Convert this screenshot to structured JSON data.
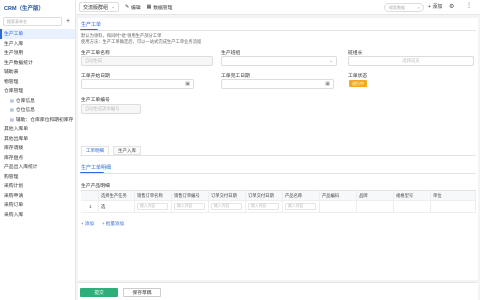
{
  "app": {
    "title": "CRM（生产版）"
  },
  "sidebar": {
    "search_placeholder": "搜索表单名",
    "items": [
      {
        "label": "生产工单",
        "active": true,
        "indent": false
      },
      {
        "label": "生产入库",
        "active": false,
        "indent": false
      },
      {
        "label": "生产领用",
        "active": false,
        "indent": false
      },
      {
        "label": "生产数据统计",
        "active": false,
        "indent": false
      },
      {
        "label": "辅助表",
        "active": false,
        "indent": false
      },
      {
        "label": "物管理",
        "active": false,
        "indent": false
      },
      {
        "label": "仓库管理",
        "active": false,
        "indent": false
      },
      {
        "label": "仓库信息",
        "active": false,
        "indent": true
      },
      {
        "label": "仓位信息",
        "active": false,
        "indent": true
      },
      {
        "label": "辅助：仓库库位和期初库存",
        "active": false,
        "indent": true
      },
      {
        "label": "其他入库单",
        "active": false,
        "indent": false
      },
      {
        "label": "其他出库单",
        "active": false,
        "indent": false
      },
      {
        "label": "库存调拨",
        "active": false,
        "indent": false
      },
      {
        "label": "库存盘点",
        "active": false,
        "indent": false
      },
      {
        "label": "产品出入库统计",
        "active": false,
        "indent": false
      },
      {
        "label": "购管理",
        "active": false,
        "indent": false
      },
      {
        "label": "采购计划",
        "active": false,
        "indent": false
      },
      {
        "label": "采购申请",
        "active": false,
        "indent": false
      },
      {
        "label": "采购订单",
        "active": false,
        "indent": false
      },
      {
        "label": "采购入库",
        "active": false,
        "indent": false
      }
    ]
  },
  "topbar": {
    "app_select": "交流版群组",
    "edit_label": "编辑",
    "manage_label": "数据管理",
    "search_placeholder": "搜索数据",
    "add_label": "添加"
  },
  "form": {
    "section_title": "生产工单",
    "notes": [
      "默认为领料，和同时\"批\"领用生产部分工单",
      "使用方法：生产工单确定后，可以一站式完成生产工单业务流程"
    ],
    "fields": {
      "order_name": {
        "label": "生产工单名称",
        "placeholder": "自动生成"
      },
      "team": {
        "label": "生产班组",
        "placeholder": ""
      },
      "leader": {
        "label": "班组长",
        "placeholder": "选择成员"
      },
      "start_date": {
        "label": "工单开始日期",
        "placeholder": ""
      },
      "end_date": {
        "label": "工单完工日期",
        "placeholder": ""
      },
      "status": {
        "label": "工单状态",
        "value": "进行中"
      },
      "order_no": {
        "label": "生产工单编号",
        "placeholder": "自动生成流水编号"
      }
    },
    "tabs": [
      "工单明细",
      "生产入库"
    ],
    "detail_title": "生产工单明细",
    "product_detail_label": "生产产品明细",
    "table": {
      "columns": [
        "选择生产任务",
        "销售订单名称",
        "销售订单编号",
        "订单交付日期",
        "订单交付日期",
        "产品名称",
        "产品编码",
        "品牌",
        "规格型号",
        "单位"
      ],
      "rows": [
        {
          "index": "1",
          "first": "选",
          "placeholder": "输入内容"
        }
      ]
    },
    "add_link": "添加",
    "batch_link": "批量添加"
  },
  "footer": {
    "submit_label": "提交",
    "draft_label": "保存草稿"
  }
}
